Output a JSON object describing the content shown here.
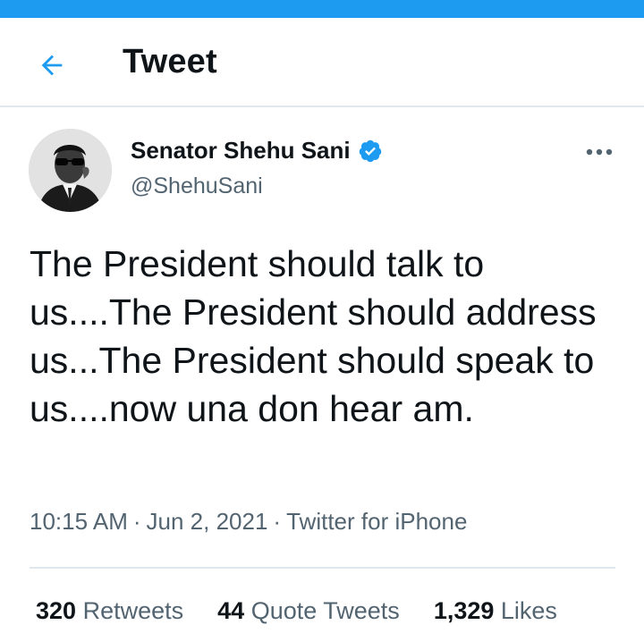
{
  "colors": {
    "accent": "#1d9bf0",
    "secondary_text": "#536471",
    "primary_text": "#0f1419"
  },
  "header": {
    "title": "Tweet",
    "back_icon": "arrow-left-icon"
  },
  "tweet": {
    "author": {
      "name": "Senator Shehu Sani",
      "handle": "@ShehuSani",
      "verified": true
    },
    "text": "The President should talk to us....The President should address us...The President should speak to us....now una don hear am.",
    "time": "10:15 AM",
    "date": "Jun 2, 2021",
    "source": "Twitter for iPhone",
    "separator": "·"
  },
  "stats": {
    "retweets": {
      "count": "320",
      "label": "Retweets"
    },
    "quotes": {
      "count": "44",
      "label": "Quote Tweets"
    },
    "likes": {
      "count": "1,329",
      "label": "Likes"
    }
  }
}
